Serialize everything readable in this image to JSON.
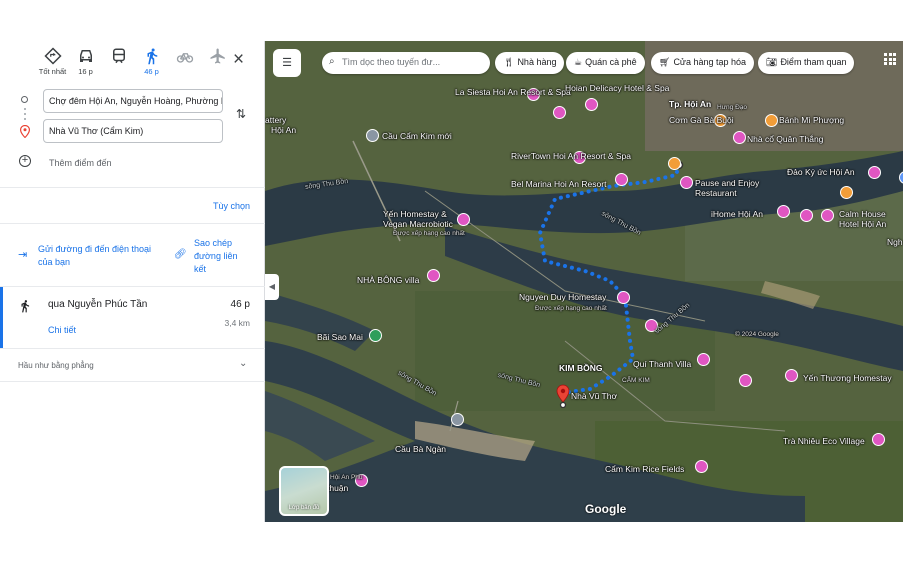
{
  "modes": [
    {
      "name": "best",
      "label": "Tốt nhất"
    },
    {
      "name": "car",
      "label": "16 p"
    },
    {
      "name": "transit",
      "label": ""
    },
    {
      "name": "walk",
      "label": "46 p"
    },
    {
      "name": "bike",
      "label": ""
    },
    {
      "name": "flight",
      "label": ""
    }
  ],
  "origin": "Chợ đêm Hội An, Nguyễn Hoàng, Phường Min",
  "destination": "Nhà Vũ Thơ (Cẩm Kim)",
  "add_stop": "Thêm điểm đến",
  "options": "Tùy chọn",
  "send_to_phone": "Gửi đường đi đến điện thoại của bạn",
  "copy_link": "Sao chép đường liên kết",
  "route": {
    "via": "qua Nguyễn Phúc Tần",
    "time": "46 p",
    "distance": "3,4 km",
    "details": "Chi tiết"
  },
  "terrain": "Hầu như bằng phẳng",
  "search_placeholder": "Tìm dọc theo tuyến đư...",
  "chips": [
    {
      "icon": "restaurant-icon",
      "label": "Nhà hàng"
    },
    {
      "icon": "coffee-icon",
      "label": "Quán cà phê"
    },
    {
      "icon": "cart-icon",
      "label": "Cửa hàng tạp hóa"
    },
    {
      "icon": "camera-icon",
      "label": "Điểm tham quan"
    }
  ],
  "map_labels": {
    "la_siesta": "La Siesta Hoi An Resort & Spa",
    "delicacy": "Hoian Delicacy Hotel & Spa",
    "tp_hoi_an": "Tp. Hội An",
    "hung_dao": "Hưng Đạo",
    "com_ga": "Cơm Gà Bà Buội",
    "banh_mi": "Bánh Mì Phượng",
    "ro_quan": "Nhà cổ Quân Thắng",
    "cau_cam_kim": "Cầu Cẩm Kim mới",
    "riverton": "RiverTown Hoi An Resort & Spa",
    "bel_marina": "Bel Marina Hoi An Resort",
    "pause": "Pause and Enjoy Restaurant",
    "dao_ky_uc": "Đảo Ký ức Hội An",
    "ihome": "iHome Hội An",
    "calm_house": "Calm House Hotel Hội An",
    "yen_homestay": "Yến Homestay & Vegan Macrobiotic",
    "yen_sub": "Được xếp hạng cao nhất",
    "nha_bong": "NHÀ BÔNG villa",
    "nguyen_duy": "Nguyen Duy Homestay",
    "nguyen_sub": "Được xếp hạng cao nhất",
    "bai_sao_mai": "Bãi Sao Mai",
    "kim_bong": "KIM BỒNG",
    "qui_thanh": "Quí Thanh Villa",
    "cam_kim": "CẨM KIM",
    "yen_thuong": "Yến Thương Homestay",
    "nha_vu_tho": "Nhà Vũ Thơ",
    "cau_ba_ngan": "Cầu Bà Ngàn",
    "tra_nhieu": "Trà Nhiêu Eco Village",
    "cam_kim_rice": "Cẩm Kim Rice Fields",
    "ngh": "Ngh",
    "attery": "attery",
    "hoi_an": "Hội An",
    "song_thu_bon_1": "sông Thu Bồn",
    "song_thu_bon_2": "sông Thu Bồn",
    "song_thu_bon_3": "sông Thu Bồn",
    "song_thu_bon_4": "sông Thu Bồn",
    "song_thu_bon_5": "sông Thu Bồn",
    "hoi_an_phu": "Hội An Phù",
    "thuan": "thuận",
    "copyright": "© 2024 Google"
  },
  "layers": "Lớp bản đồ",
  "brand": "Google",
  "colors": {
    "accent": "#1a73e8",
    "route": "#1a73e8",
    "pin": "#ea4335"
  }
}
